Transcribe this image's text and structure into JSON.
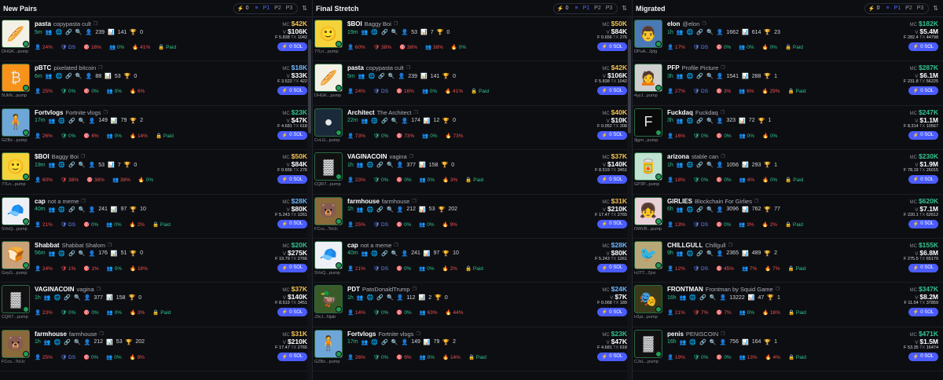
{
  "columns": [
    {
      "title": "New Pairs",
      "count": "0",
      "presets": [
        "P1",
        "P2",
        "P3"
      ],
      "selected": "P1",
      "rows": [
        {
          "sym": "pasta",
          "name": "copypasta cult",
          "age": "5m",
          "holders": "239",
          "snipers": "141",
          "pro": "0",
          "addr": "DHGK...pump",
          "mc": "$42K",
          "mcColor": "y",
          "vol": "$106K",
          "f": "5.838",
          "tx": "1042",
          "st": [
            "24%",
            "DS",
            "16%",
            "0%",
            "41%",
            "Paid"
          ],
          "icon": "🥖",
          "bg": "#f3f1e6"
        },
        {
          "sym": "pBTC",
          "name": "pixelated bitcoin",
          "age": "6m",
          "holders": "88",
          "snipers": "53",
          "pro": "0",
          "addr": "5UkN...pump",
          "mc": "$18K",
          "mcColor": "b",
          "vol": "$33K",
          "f": "3.522",
          "tx": "422",
          "st": [
            "25%",
            "0%",
            "0%",
            "0%",
            "6%",
            ""
          ],
          "icon": "₿",
          "bg": "#f7931a"
        },
        {
          "sym": "Fortvlogs",
          "name": "Fortnite vlogs",
          "age": "17m",
          "holders": "149",
          "snipers": "79",
          "pro": "2",
          "addr": "GZBz...pump",
          "mc": "$23K",
          "mcColor": "g",
          "vol": "$47K",
          "f": "4.681",
          "tx": "618",
          "st": [
            "26%",
            "0%",
            "6%",
            "0%",
            "14%",
            "Paid"
          ],
          "icon": "🧍",
          "bg": "#6fa6d8"
        },
        {
          "sym": "$BOI",
          "name": "Baggy Boi",
          "age": "19m",
          "holders": "53",
          "snipers": "7",
          "pro": "0",
          "addr": "77Ln...pump",
          "mc": "$50K",
          "mcColor": "y",
          "vol": "$84K",
          "f": "0.656",
          "tx": "276",
          "st": [
            "60%",
            "38%",
            "38%",
            "38%",
            "0%",
            ""
          ],
          "icon": "🙂",
          "bg": "#f4d23a"
        },
        {
          "sym": "cap",
          "name": "not a meme",
          "age": "40m",
          "holders": "241",
          "snipers": "97",
          "pro": "10",
          "addr": "SVoQ...pump",
          "mc": "$28K",
          "mcColor": "b",
          "vol": "$80K",
          "f": "5.243",
          "tx": "1261",
          "st": [
            "21%",
            "DS",
            "0%",
            "0%",
            "2%",
            "Paid"
          ],
          "icon": "🧢",
          "bg": "#eef0f5"
        },
        {
          "sym": "Shabbat",
          "name": "Shabbat Shalom",
          "age": "56m",
          "holders": "176",
          "snipers": "51",
          "pro": "0",
          "addr": "GxyG...pump",
          "mc": "$20K",
          "mcColor": "g",
          "vol": "$275K",
          "f": "19.79",
          "tx": "2766",
          "st": [
            "24%",
            "1%",
            "1%",
            "0%",
            "16%",
            ""
          ],
          "icon": "🍞",
          "bg": "#c9a27a"
        },
        {
          "sym": "VAGINACOIN",
          "name": "vagina",
          "age": "1h",
          "holders": "377",
          "snipers": "158",
          "pro": "0",
          "addr": "CQR7...pump",
          "mc": "$37K",
          "mcColor": "y",
          "vol": "$140K",
          "f": "8.519",
          "tx": "3451",
          "st": [
            "23%",
            "0%",
            "0%",
            "0%",
            "3%",
            "Paid"
          ],
          "icon": "▓",
          "bg": "#111"
        },
        {
          "sym": "farmhouse",
          "name": "farmhouse",
          "age": "1h",
          "holders": "212",
          "snipers": "53",
          "pro": "202",
          "addr": "FCcs...ToUc",
          "mc": "$31K",
          "mcColor": "y",
          "vol": "$210K",
          "f": "17.47",
          "tx": "2765",
          "st": [
            "25%",
            "DS",
            "0%",
            "0%",
            "9%",
            ""
          ],
          "icon": "🐻",
          "bg": "#8a6a3a"
        }
      ]
    },
    {
      "title": "Final Stretch",
      "count": "0",
      "presets": [
        "P1",
        "P2",
        "P3"
      ],
      "selected": "P1",
      "rows": [
        {
          "sym": "$BOI",
          "name": "Baggy Boi",
          "age": "19m",
          "holders": "53",
          "snipers": "7",
          "pro": "0",
          "addr": "77Ln...pump",
          "mc": "$50K",
          "mcColor": "y",
          "vol": "$84K",
          "f": "0.656",
          "tx": "276",
          "st": [
            "60%",
            "38%",
            "38%",
            "38%",
            "0%",
            ""
          ],
          "icon": "🙂",
          "bg": "#f4d23a"
        },
        {
          "sym": "pasta",
          "name": "copypasta cult",
          "age": "5m",
          "holders": "239",
          "snipers": "141",
          "pro": "0",
          "addr": "DHGK...pump",
          "mc": "$42K",
          "mcColor": "y",
          "vol": "$106K",
          "f": "5.838",
          "tx": "1042",
          "st": [
            "24%",
            "DS",
            "16%",
            "0%",
            "41%",
            "Paid"
          ],
          "icon": "🥖",
          "bg": "#f3f1e6"
        },
        {
          "sym": "Architect",
          "name": "The Architect",
          "age": "22m",
          "holders": "174",
          "snipers": "12",
          "pro": "0",
          "addr": "CvLG...pump",
          "mc": "$40K",
          "mcColor": "y",
          "vol": "$10K",
          "f": "0.052",
          "tx": "208",
          "st": [
            "73%",
            "0%",
            "73%",
            "0%",
            "73%",
            ""
          ],
          "icon": "●",
          "bg": "#1b2a3a"
        },
        {
          "sym": "VAGINACOIN",
          "name": "vagina",
          "age": "1h",
          "holders": "377",
          "snipers": "158",
          "pro": "0",
          "addr": "CQR7...pump",
          "mc": "$37K",
          "mcColor": "y",
          "vol": "$140K",
          "f": "8.519",
          "tx": "3451",
          "st": [
            "23%",
            "0%",
            "0%",
            "0%",
            "3%",
            "Paid"
          ],
          "icon": "▓",
          "bg": "#111"
        },
        {
          "sym": "farmhouse",
          "name": "farmhouse",
          "age": "1h",
          "holders": "212",
          "snipers": "53",
          "pro": "202",
          "addr": "FCcs...ToUc",
          "mc": "$31K",
          "mcColor": "y",
          "vol": "$210K",
          "f": "17.47",
          "tx": "2765",
          "st": [
            "25%",
            "DS",
            "0%",
            "0%",
            "9%",
            ""
          ],
          "icon": "🐻",
          "bg": "#8a6a3a"
        },
        {
          "sym": "cap",
          "name": "not a meme",
          "age": "40m",
          "holders": "241",
          "snipers": "97",
          "pro": "10",
          "addr": "SVoQ...pump",
          "mc": "$28K",
          "mcColor": "b",
          "vol": "$80K",
          "f": "5.243",
          "tx": "1261",
          "st": [
            "21%",
            "DS",
            "0%",
            "0%",
            "2%",
            "Paid"
          ],
          "icon": "🧢",
          "bg": "#eef0f5"
        },
        {
          "sym": "PDT",
          "name": "PatoDonaldTrump",
          "age": "1h",
          "holders": "112",
          "snipers": "2",
          "pro": "0",
          "addr": "J3cJ...Njab",
          "mc": "$24K",
          "mcColor": "b",
          "vol": "$7K",
          "f": "0.068",
          "tx": "189",
          "st": [
            "14%",
            "0%",
            "0%",
            "63%",
            "44%",
            ""
          ],
          "icon": "🦆",
          "bg": "#3a5a2a"
        },
        {
          "sym": "Fortvlogs",
          "name": "Fortnite vlogs",
          "age": "17m",
          "holders": "149",
          "snipers": "79",
          "pro": "2",
          "addr": "GZBz...pump",
          "mc": "$23K",
          "mcColor": "g",
          "vol": "$47K",
          "f": "4.681",
          "tx": "618",
          "st": [
            "26%",
            "0%",
            "6%",
            "0%",
            "14%",
            "Paid"
          ],
          "icon": "🧍",
          "bg": "#6fa6d8"
        }
      ]
    },
    {
      "title": "Migrated",
      "count": "0",
      "presets": [
        "P1",
        "P2",
        "P3"
      ],
      "selected": "P1",
      "rows": [
        {
          "sym": "elon",
          "name": "@elon",
          "age": "1h",
          "holders": "1662",
          "snipers": "614",
          "pro": "23",
          "addr": "DPuA...2jdg",
          "mc": "$182K",
          "mcColor": "g",
          "vol": "$5.4M",
          "f": "282.4",
          "tx": "44798",
          "st": [
            "17%",
            "DS",
            "0%",
            "0%",
            "0%",
            "Paid"
          ],
          "icon": "👨",
          "bg": "#4a7ab5"
        },
        {
          "sym": "PFP",
          "name": "Profile Picture",
          "age": "3h",
          "holders": "1541",
          "snipers": "288",
          "pro": "1",
          "addr": "4yyJ...pump",
          "mc": "$287K",
          "mcColor": "g",
          "vol": "$6.1M",
          "f": "231.8",
          "tx": "56225",
          "st": [
            "27%",
            "DS",
            "3%",
            "6%",
            "29%",
            "Paid"
          ],
          "icon": "🙍",
          "bg": "#cfcfcf"
        },
        {
          "sym": "Fuckdaq",
          "name": "Fuckdaq",
          "age": "3h",
          "holders": "323",
          "snipers": "72",
          "pro": "1",
          "addr": "9jgm...pump",
          "mc": "$247K",
          "mcColor": "g",
          "vol": "$1.1M",
          "f": "8.314",
          "tx": "10567",
          "st": [
            "16%",
            "0%",
            "0%",
            "0%",
            "0%",
            ""
          ],
          "icon": "F",
          "bg": "#0a0a0a"
        },
        {
          "sym": "arizona",
          "name": "stable can",
          "age": "1h",
          "holders": "1056",
          "snipers": "293",
          "pro": "1",
          "addr": "GP3P...pump",
          "mc": "$230K",
          "mcColor": "g",
          "vol": "$1.9M",
          "f": "78.19",
          "tx": "26015",
          "st": [
            "18%",
            "0%",
            "0%",
            "4%",
            "0%",
            "Paid"
          ],
          "icon": "🥫",
          "bg": "#bfe3d0"
        },
        {
          "sym": "GIRLIES",
          "name": "Blockchain For Girlies",
          "age": "6h",
          "holders": "3096",
          "snipers": "762",
          "pro": "77",
          "addr": "DWVB...pump",
          "mc": "$620K",
          "mcColor": "g",
          "vol": "$7.1M",
          "f": "220.1",
          "tx": "62612",
          "st": [
            "13%",
            "DS",
            "0%",
            "3%",
            "2%",
            "Paid"
          ],
          "icon": "👧",
          "bg": "#e8d0d8"
        },
        {
          "sym": "CHILLGULL",
          "name": "Chillgull",
          "age": "9h",
          "holders": "2365",
          "snipers": "489",
          "pro": "2",
          "addr": "HJTT...2jnz",
          "mc": "$155K",
          "mcColor": "g",
          "vol": "$6.8M",
          "f": "275.5",
          "tx": "65179",
          "st": [
            "12%",
            "DS",
            "45%",
            "7%",
            "7%",
            "Paid"
          ],
          "icon": "🐦",
          "bg": "#b8a878"
        },
        {
          "sym": "FRONTMAN",
          "name": "Frontman by Squid Game",
          "age": "16h",
          "holders": "13222",
          "snipers": "47",
          "pro": "1",
          "addr": "H1pi...pump",
          "mc": "$347K",
          "mcColor": "g",
          "vol": "$8.2M",
          "f": "11.54",
          "tx": "37859",
          "st": [
            "21%",
            "7%",
            "7%",
            "0%",
            "16%",
            "Paid"
          ],
          "icon": "🎭",
          "bg": "#3a3a1a"
        },
        {
          "sym": "penis",
          "name": "PENISCOIN",
          "age": "16h",
          "holders": "756",
          "snipers": "164",
          "pro": "1",
          "addr": "CJsL...pump",
          "mc": "$471K",
          "mcColor": "g",
          "vol": "$1.5M",
          "f": "53.35",
          "tx": "16474",
          "st": [
            "19%",
            "0%",
            "0%",
            "13%",
            "4%",
            "Paid"
          ],
          "icon": "▓",
          "bg": "#111"
        }
      ]
    }
  ],
  "labels": {
    "mc": "MC",
    "vol": "V",
    "f": "F",
    "tx": "TX",
    "buy": "0 SOL"
  }
}
